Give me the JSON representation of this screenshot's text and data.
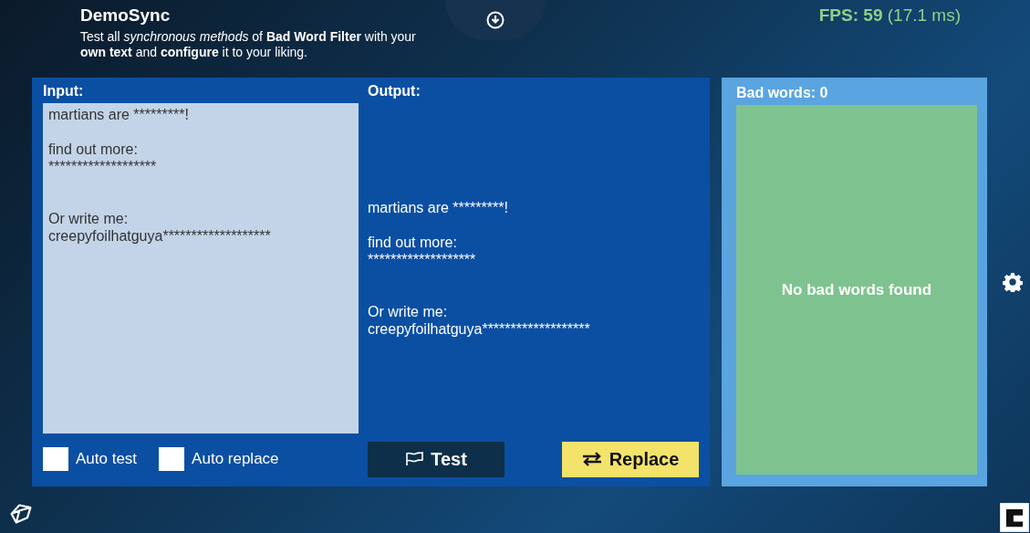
{
  "header": {
    "title": "DemoSync",
    "description": "Test all *synchronous methods* of **Bad Word Filter** with your **own text** and **configure** it to your liking.",
    "fps_label": "FPS: 59",
    "fps_time": "(17.1 ms)"
  },
  "input": {
    "label": "Input:",
    "text": "martians are *********!\n\nfind out more:\n*******************\n\n\nOr write me:\ncreepyfoilhatguya*******************"
  },
  "output": {
    "label": "Output:",
    "text": "martians are *********!\n\nfind out more:\n*******************\n\n\nOr write me:\ncreepyfoilhatguya*******************"
  },
  "options": [
    {
      "label": "Auto test",
      "checked": false
    },
    {
      "label": "Auto replace",
      "checked": false
    }
  ],
  "buttons": [
    {
      "kind": "test",
      "label": "Test"
    },
    {
      "kind": "replace",
      "label": "Replace"
    }
  ],
  "bad_words": {
    "title": "Bad words: 0",
    "message": "No bad words found"
  }
}
